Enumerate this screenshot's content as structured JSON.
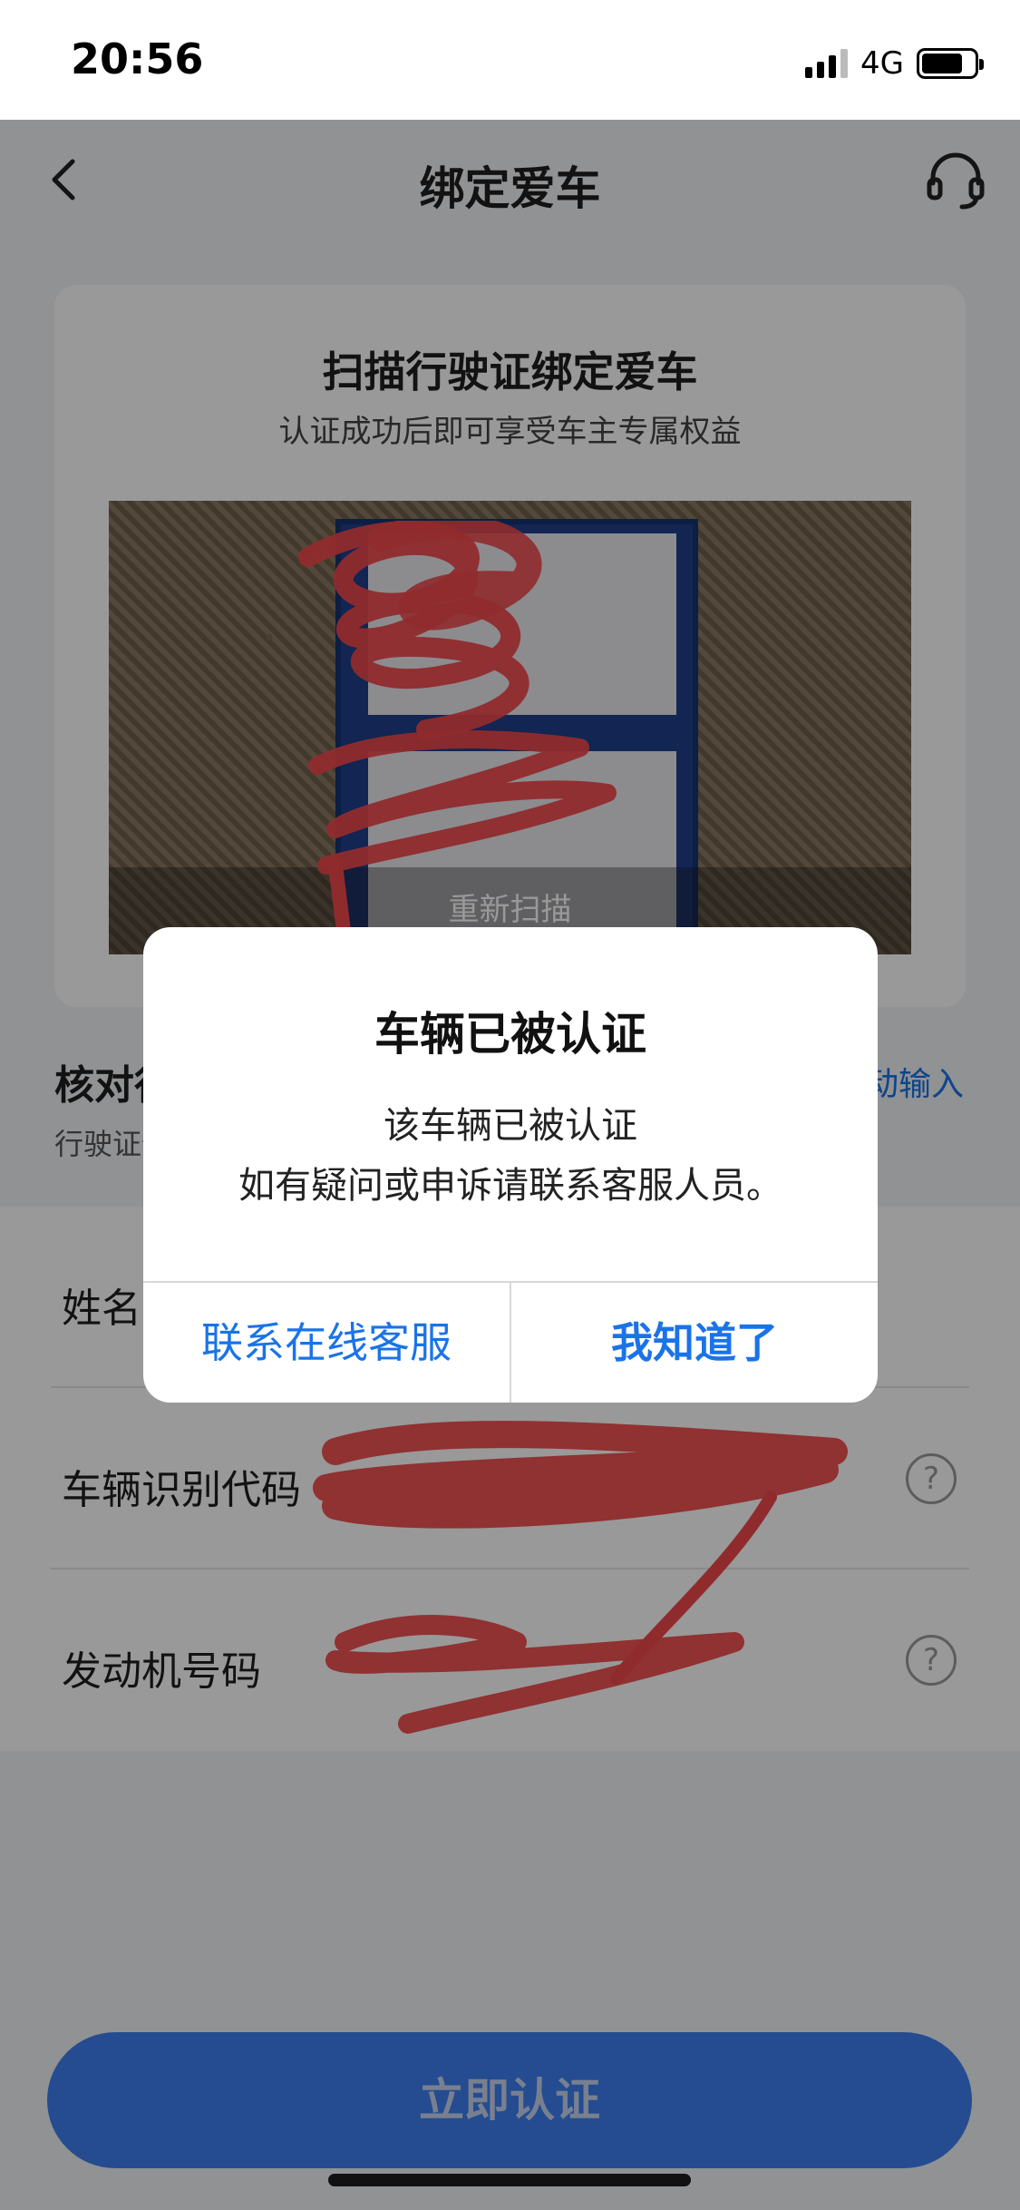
{
  "status_bar": {
    "time": "20:56",
    "network": "4G"
  },
  "nav": {
    "title": "绑定爱车",
    "back_icon": "chevron-left-icon",
    "service_icon": "headset-icon"
  },
  "scan_card": {
    "title": "扫描行驶证绑定爱车",
    "subtitle": "认证成功后即可享受车主专属权益",
    "rescan_label": "重新扫描"
  },
  "verify": {
    "title": "核对行驶证信息",
    "subtitle": "行驶证信息",
    "manual_input": "手动输入"
  },
  "form": {
    "rows": [
      {
        "label": "姓名"
      },
      {
        "label": "车辆识别代码",
        "help": "?"
      },
      {
        "label": "发动机号码",
        "help": "?"
      }
    ]
  },
  "submit_label": "立即认证",
  "dialog": {
    "title": "车辆已被认证",
    "message_line1": "该车辆已被认证",
    "message_line2": "如有疑问或申诉请联系客服人员。",
    "secondary_button": "联系在线客服",
    "primary_button": "我知道了"
  },
  "colors": {
    "accent": "#1a73e8",
    "submit_button": "#3f7ff0",
    "scribble": "#f0494b",
    "overlay": "rgba(0,0,0,0.40)"
  }
}
